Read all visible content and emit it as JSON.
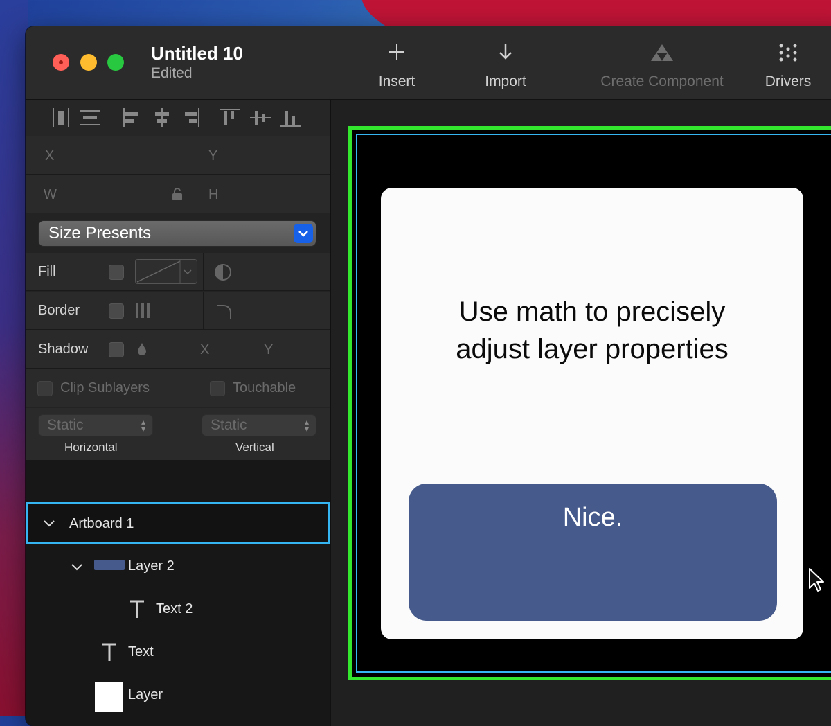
{
  "window": {
    "title": "Untitled 10",
    "subtitle": "Edited"
  },
  "toolbar": {
    "items": [
      {
        "label": "Insert",
        "icon": "plus-icon",
        "enabled": true
      },
      {
        "label": "Import",
        "icon": "arrow-down-icon",
        "enabled": true
      },
      {
        "label": "Create Component",
        "icon": "component-icon",
        "enabled": false
      },
      {
        "label": "Drivers",
        "icon": "drivers-grid-icon",
        "enabled": true
      }
    ]
  },
  "inspector": {
    "x_label": "X",
    "y_label": "Y",
    "w_label": "W",
    "h_label": "H",
    "size_presets_label": "Size Presents",
    "fill_label": "Fill",
    "border_label": "Border",
    "shadow_label": "Shadow",
    "shadow_x_label": "X",
    "shadow_y_label": "Y",
    "clip_sublayers_label": "Clip Sublayers",
    "touchable_label": "Touchable",
    "horizontal_value": "Static",
    "vertical_value": "Static",
    "horizontal_label": "Horizontal",
    "vertical_label": "Vertical"
  },
  "layers": [
    {
      "name": "Artboard 1",
      "type": "artboard",
      "depth": 0,
      "expanded": true,
      "selected": true
    },
    {
      "name": "Layer 2",
      "type": "layer",
      "depth": 1,
      "expanded": true,
      "swatch": "#465a8b"
    },
    {
      "name": "Text 2",
      "type": "text",
      "depth": 2
    },
    {
      "name": "Text",
      "type": "text",
      "depth": 1
    },
    {
      "name": "Layer",
      "type": "layer",
      "depth": 1,
      "swatch": "#ffffff"
    }
  ],
  "canvas": {
    "card_text": "Use math to precisely adjust layer properties",
    "button_text": "Nice."
  },
  "colors": {
    "selection_blue": "#35b6f2",
    "artboard_green": "#33e72e",
    "button_blue": "#465a8b",
    "card_white": "#fbfbfb",
    "select_accent": "#1760e8"
  }
}
